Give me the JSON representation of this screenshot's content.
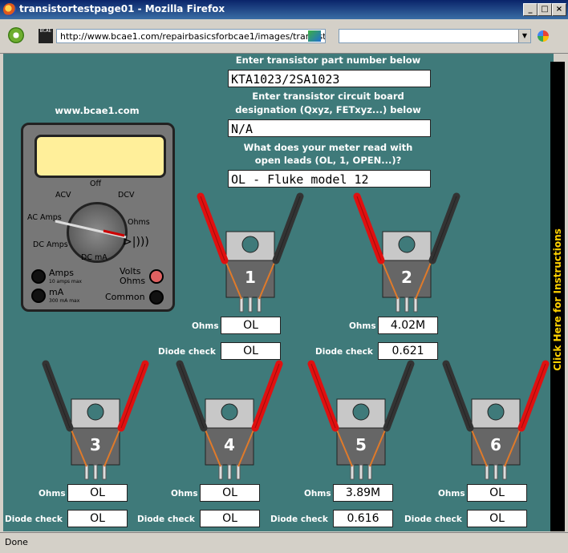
{
  "window": {
    "title": "transistortestpage01 - Mozilla Firefox"
  },
  "toolbar": {
    "url": "http://www.bcae1.com/repairbasicsforbcae1/images/transistor",
    "site_icon_text": "BCAE"
  },
  "page": {
    "part_label": "Enter transistor part number below",
    "part_value": "KTA1023/2SA1023",
    "designation_label_line1": "Enter transistor circuit board",
    "designation_label_line2": "designation (Qxyz, FETxyz...) below",
    "designation_value": "N/A",
    "meter_read_label_line1": "What does your meter read with",
    "meter_read_label_line2": "open leads (OL, 1, OPEN...)?",
    "meter_read_value": "OL - Fluke model 12",
    "site_name": "www.bcae1.com",
    "instructions": "Click Here for Instructions"
  },
  "meter": {
    "off": "Off",
    "acv": "ACV",
    "dcv": "DCV",
    "ac_amps": "AC Amps",
    "ohms": "Ohms",
    "dc_amps": "DC Amps",
    "dc_ma": "DC mA",
    "amps": "Amps",
    "amps_max": "10 amps max",
    "ma": "mA",
    "ma_max": "300 mA max",
    "volts": "Volts",
    "volts_ohms": "Ohms",
    "common": "Common"
  },
  "tests": [
    {
      "number": "1",
      "ohms": "OL",
      "diode": "OL"
    },
    {
      "number": "2",
      "ohms": "4.02M",
      "diode": "0.621"
    },
    {
      "number": "3",
      "ohms": "OL",
      "diode": "OL"
    },
    {
      "number": "4",
      "ohms": "OL",
      "diode": "OL"
    },
    {
      "number": "5",
      "ohms": "3.89M",
      "diode": "0.616"
    },
    {
      "number": "6",
      "ohms": "OL",
      "diode": "OL"
    }
  ],
  "row_labels": {
    "ohms": "Ohms",
    "diode": "Diode check"
  },
  "status": "Done",
  "colors": {
    "page_bg": "#3f7a7a",
    "red_probe": "#e01010",
    "black_probe": "#333333",
    "instructions_text": "#ffd200"
  }
}
